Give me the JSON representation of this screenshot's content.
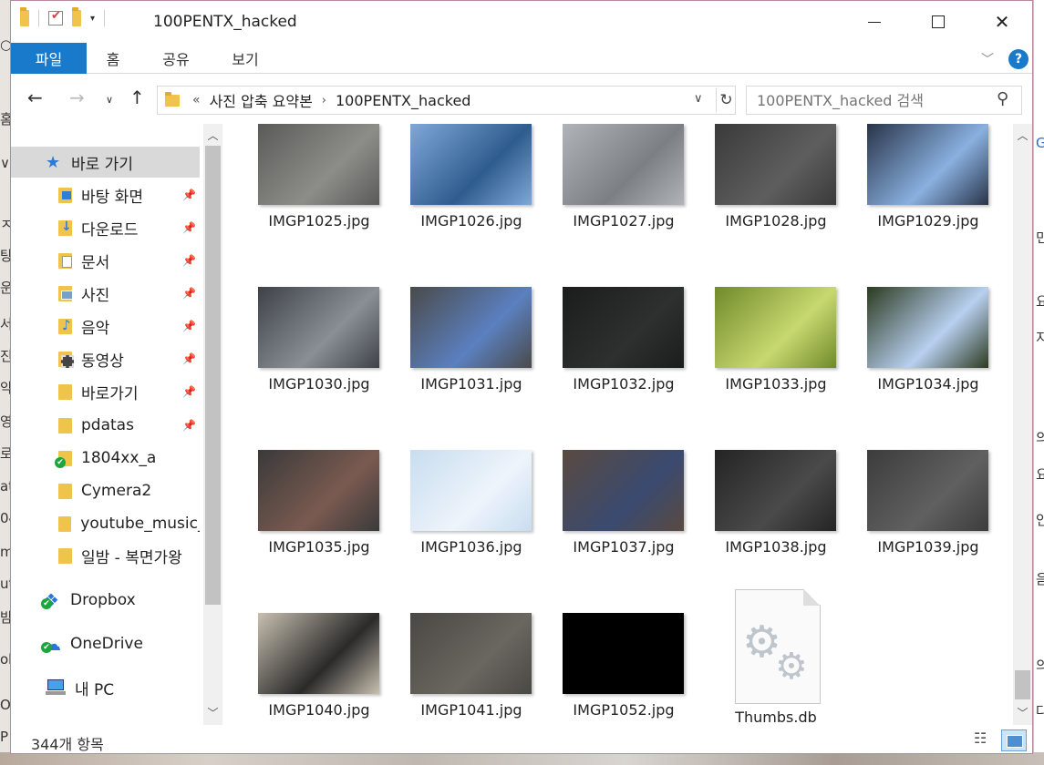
{
  "window": {
    "title": "100PENTX_hacked"
  },
  "ribbon": {
    "tabs": [
      {
        "label": "파일"
      },
      {
        "label": "홈"
      },
      {
        "label": "공유"
      },
      {
        "label": "보기"
      }
    ],
    "help": "?"
  },
  "address": {
    "overflow": "«",
    "crumbs": [
      "사진 압축 요약본",
      "100PENTX_hacked"
    ],
    "separator": "›"
  },
  "search": {
    "placeholder": "100PENTX_hacked 검색"
  },
  "sidebar": {
    "quick_access": "바로 가기",
    "items": [
      {
        "label": "바탕 화면",
        "icon": "desktop-folder-icon",
        "pinned": true
      },
      {
        "label": "다운로드",
        "icon": "downloads-folder-icon",
        "pinned": true
      },
      {
        "label": "문서",
        "icon": "documents-folder-icon",
        "pinned": true
      },
      {
        "label": "사진",
        "icon": "pictures-folder-icon",
        "pinned": true
      },
      {
        "label": "음악",
        "icon": "music-folder-icon",
        "pinned": true
      },
      {
        "label": "동영상",
        "icon": "videos-folder-icon",
        "pinned": true
      },
      {
        "label": "바로가기",
        "icon": "folder-icon",
        "pinned": true
      },
      {
        "label": "pdatas",
        "icon": "folder-icon",
        "pinned": true
      },
      {
        "label": "1804xx_a",
        "icon": "synced-folder-icon",
        "pinned": false
      },
      {
        "label": "Cymera2",
        "icon": "folder-icon",
        "pinned": false
      },
      {
        "label": "youtube_music_",
        "icon": "folder-icon",
        "pinned": false
      },
      {
        "label": "일밤 - 복면가왕",
        "icon": "folder-icon",
        "pinned": false
      }
    ],
    "dropbox": "Dropbox",
    "onedrive": "OneDrive",
    "pc": "내 PC",
    "partial": "..."
  },
  "files": [
    {
      "name": "IMGP1025.jpg",
      "c1": "#5a5a5a",
      "c2": "#8d8d88"
    },
    {
      "name": "IMGP1026.jpg",
      "c1": "#7fa8d8",
      "c2": "#2f5c8e"
    },
    {
      "name": "IMGP1027.jpg",
      "c1": "#b0b4b8",
      "c2": "#7c8085"
    },
    {
      "name": "IMGP1028.jpg",
      "c1": "#3a3a3a",
      "c2": "#5e5e5e"
    },
    {
      "name": "IMGP1029.jpg",
      "c1": "#283448",
      "c2": "#8ab0e0"
    },
    {
      "name": "IMGP1030.jpg",
      "c1": "#3e4248",
      "c2": "#8a8f96"
    },
    {
      "name": "IMGP1031.jpg",
      "c1": "#4a4a4a",
      "c2": "#5b80c0"
    },
    {
      "name": "IMGP1032.jpg",
      "c1": "#1b1d1d",
      "c2": "#2e3030"
    },
    {
      "name": "IMGP1033.jpg",
      "c1": "#6f8a2a",
      "c2": "#c8d870"
    },
    {
      "name": "IMGP1034.jpg",
      "c1": "#2c3a20",
      "c2": "#b8d0f0"
    },
    {
      "name": "IMGP1035.jpg",
      "c1": "#3a3a3a",
      "c2": "#7a5a50"
    },
    {
      "name": "IMGP1036.jpg",
      "c1": "#c8ddf0",
      "c2": "#eef4fb"
    },
    {
      "name": "IMGP1037.jpg",
      "c1": "#5a4a40",
      "c2": "#3a4a70"
    },
    {
      "name": "IMGP1038.jpg",
      "c1": "#242424",
      "c2": "#4a4a4a"
    },
    {
      "name": "IMGP1039.jpg",
      "c1": "#3c3c3c",
      "c2": "#606060"
    },
    {
      "name": "IMGP1040.jpg",
      "c1": "#c8c0b0",
      "c2": "#2a2a2a"
    },
    {
      "name": "IMGP1041.jpg",
      "c1": "#4a4844",
      "c2": "#6a6660"
    },
    {
      "name": "IMGP1052.jpg",
      "c1": "#000000",
      "c2": "#000000"
    },
    {
      "name": "Thumbs.db",
      "type": "system-file"
    }
  ],
  "status": {
    "count": "344개 항목"
  }
}
